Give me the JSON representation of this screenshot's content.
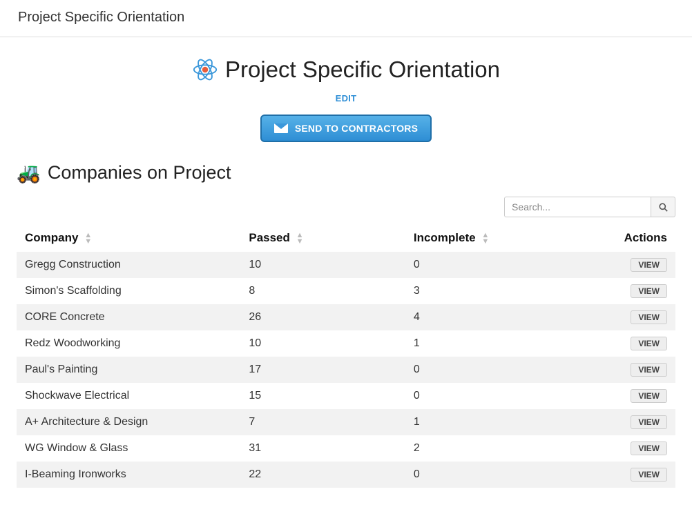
{
  "topbar": {
    "title": "Project Specific Orientation"
  },
  "header": {
    "title": "Project Specific Orientation",
    "edit_label": "EDIT",
    "send_button_label": "SEND TO CONTRACTORS"
  },
  "section": {
    "heading": "Companies on Project"
  },
  "search": {
    "placeholder": "Search..."
  },
  "table": {
    "columns": {
      "company": "Company",
      "passed": "Passed",
      "incomplete": "Incomplete",
      "actions": "Actions"
    },
    "view_label": "VIEW",
    "rows": [
      {
        "company": "Gregg Construction",
        "passed": "10",
        "incomplete": "0"
      },
      {
        "company": "Simon's Scaffolding",
        "passed": "8",
        "incomplete": "3"
      },
      {
        "company": "CORE Concrete",
        "passed": "26",
        "incomplete": "4"
      },
      {
        "company": "Redz Woodworking",
        "passed": "10",
        "incomplete": "1"
      },
      {
        "company": "Paul's Painting",
        "passed": "17",
        "incomplete": "0"
      },
      {
        "company": "Shockwave Electrical",
        "passed": "15",
        "incomplete": "0"
      },
      {
        "company": "A+ Architecture & Design",
        "passed": "7",
        "incomplete": "1"
      },
      {
        "company": "WG Window & Glass",
        "passed": "31",
        "incomplete": "2"
      },
      {
        "company": "I-Beaming Ironworks",
        "passed": "22",
        "incomplete": "0"
      }
    ]
  }
}
